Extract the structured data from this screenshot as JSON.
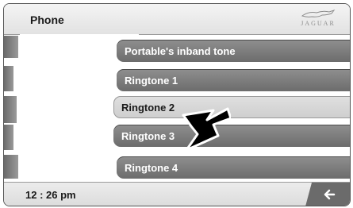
{
  "header": {
    "title": "Phone",
    "brand": "JAGUAR"
  },
  "menu": {
    "items": [
      {
        "label": "Portable's inband tone"
      },
      {
        "label": "Ringtone 1"
      },
      {
        "label": "Ringtone 2",
        "selected": true
      },
      {
        "label": "Ringtone 3"
      },
      {
        "label": "Ringtone 4"
      }
    ]
  },
  "footer": {
    "time": "12 : 26 pm",
    "back_icon": "back-arrow-icon"
  },
  "colors": {
    "item_bg": "#7f7f7f",
    "selected_bg": "#d6d6d6",
    "text_light": "#ffffff",
    "text_dark": "#1a1a1a"
  }
}
